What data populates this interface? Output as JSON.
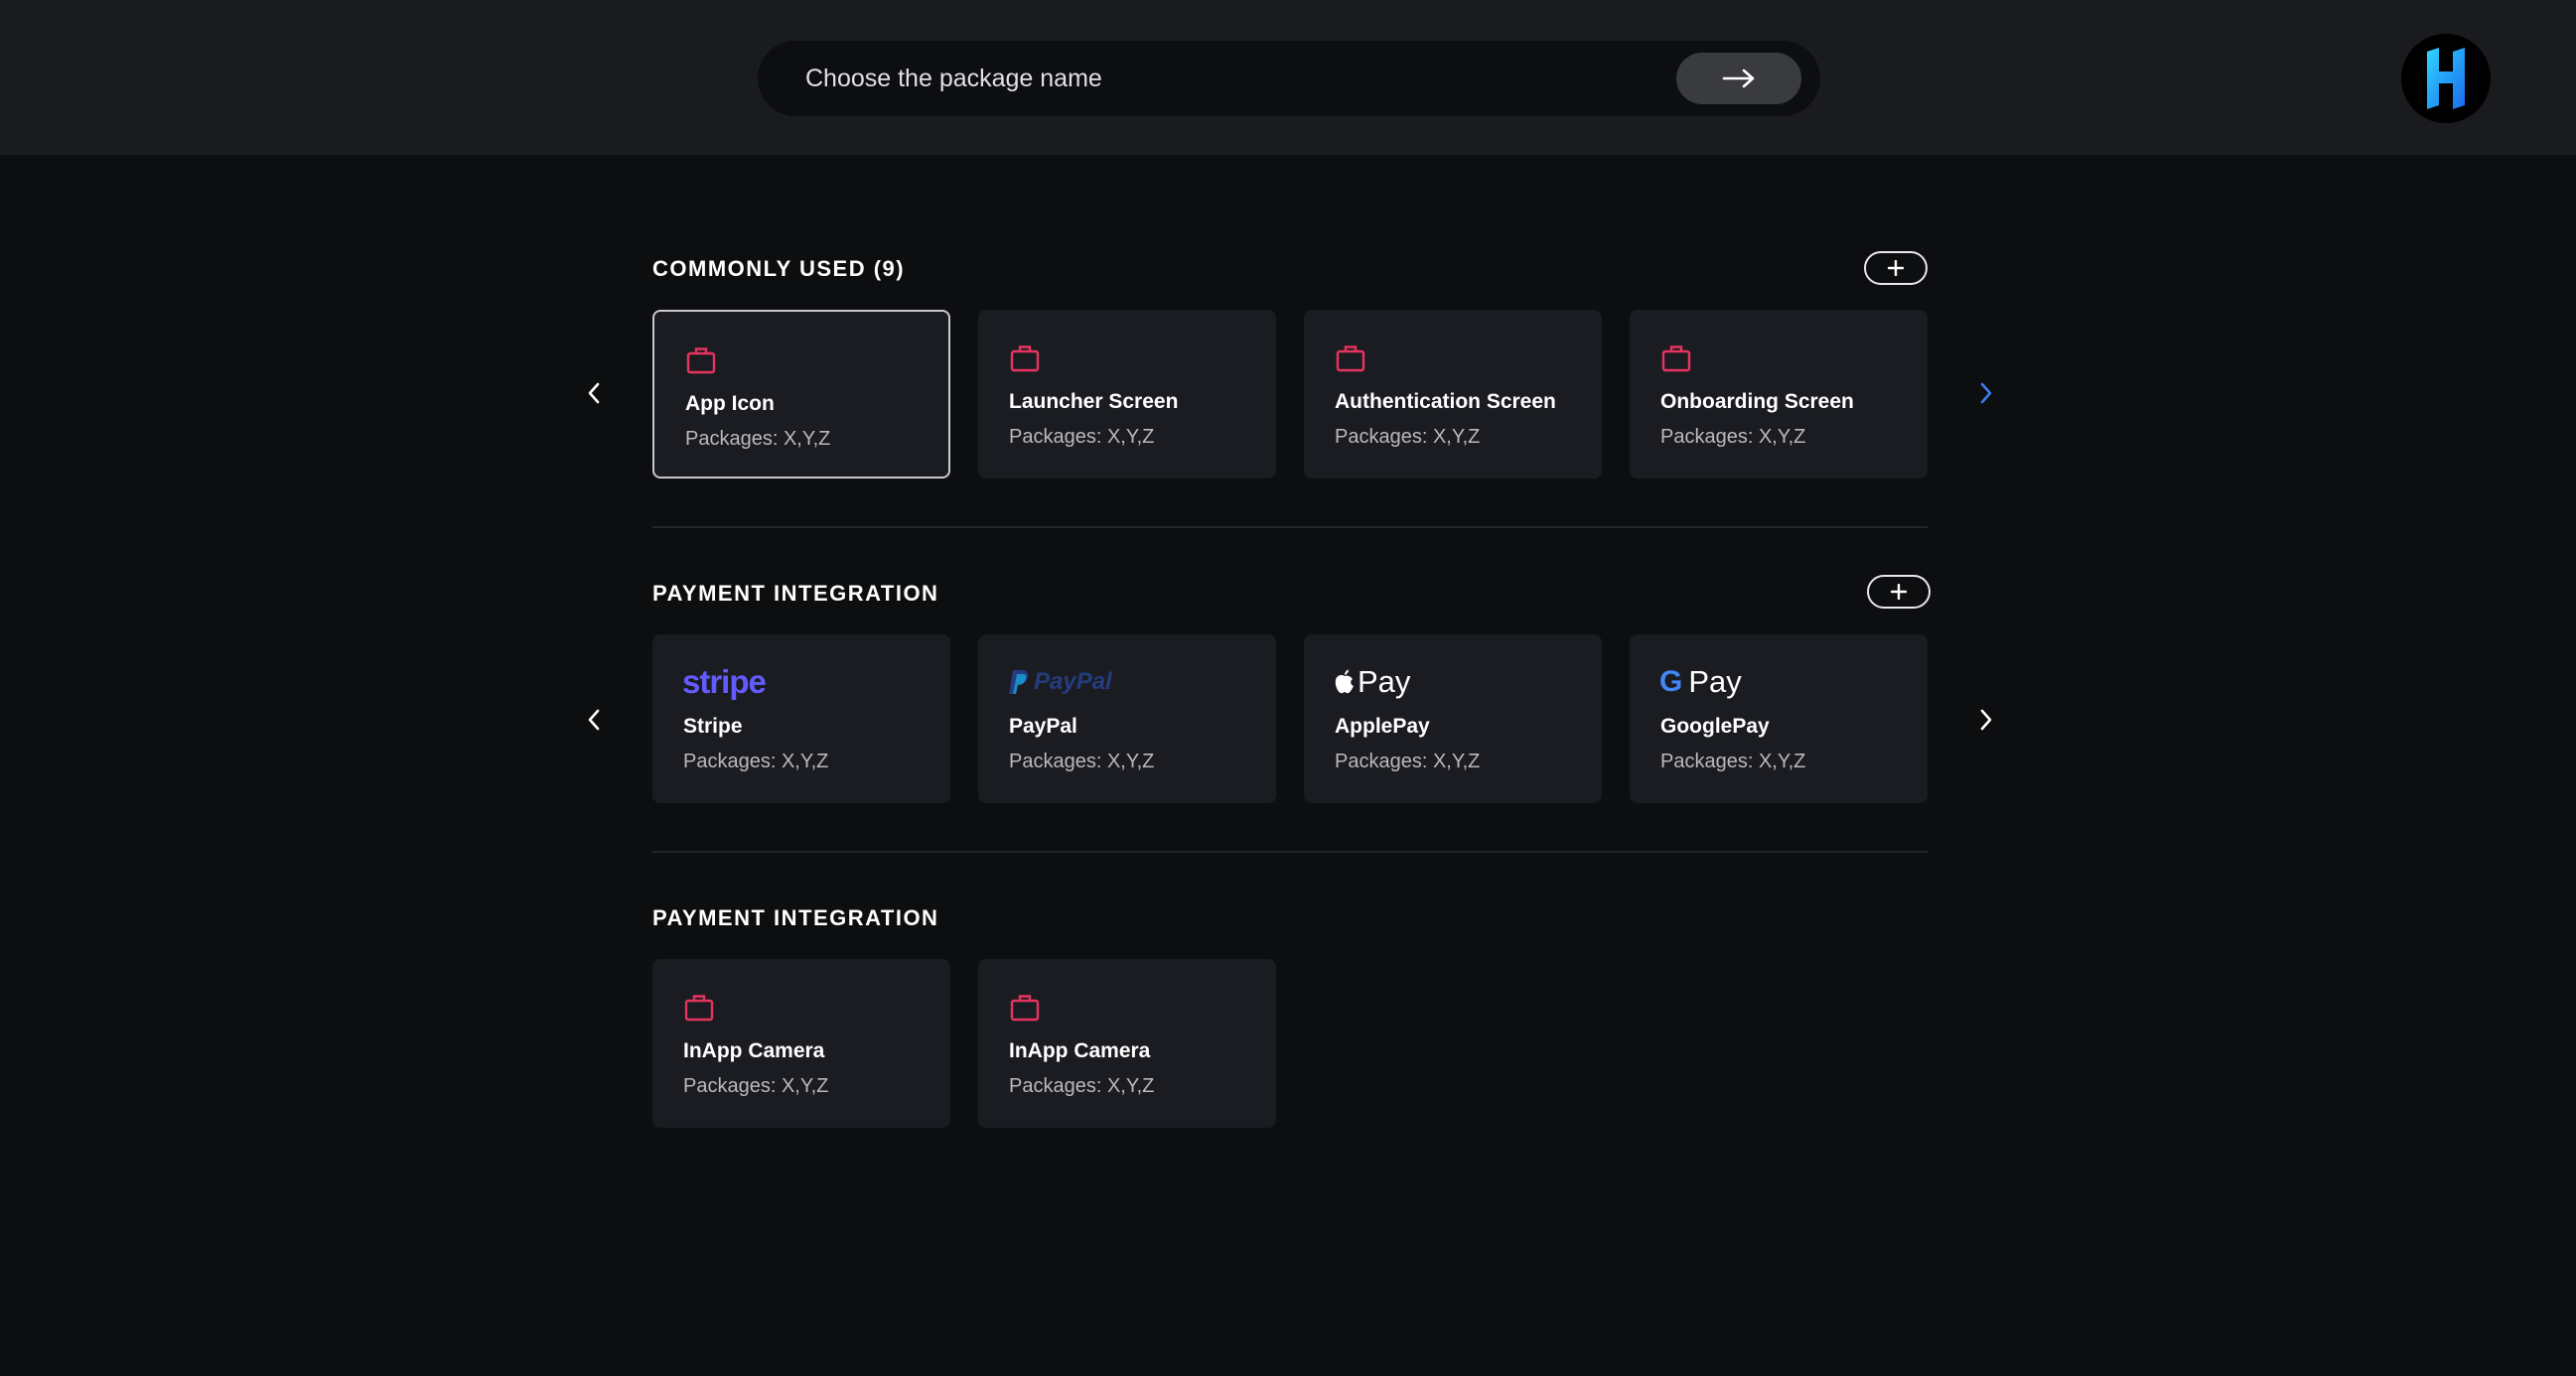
{
  "search": {
    "placeholder": "Choose the package name"
  },
  "logo": {
    "letter": "H",
    "icon": "h-logo-icon"
  },
  "sections": [
    {
      "title": "COMMONLY USED (9)",
      "cards": [
        {
          "title": "App Icon",
          "sub": "Packages: X,Y,Z",
          "icon": "briefcase-icon",
          "selected": true
        },
        {
          "title": "Launcher Screen",
          "sub": "Packages: X,Y,Z",
          "icon": "briefcase-icon"
        },
        {
          "title": "Authentication Screen",
          "sub": "Packages: X,Y,Z",
          "icon": "briefcase-icon"
        },
        {
          "title": "Onboarding Screen",
          "sub": "Packages: X,Y,Z",
          "icon": "briefcase-icon"
        }
      ]
    },
    {
      "title": "PAYMENT INTEGRATION",
      "cards": [
        {
          "title": "Stripe",
          "sub": "Packages: X,Y,Z",
          "icon": "stripe-logo",
          "brand": "stripe"
        },
        {
          "title": "PayPal",
          "sub": "Packages: X,Y,Z",
          "icon": "paypal-logo",
          "brand": "PayPal"
        },
        {
          "title": "ApplePay",
          "sub": "Packages: X,Y,Z",
          "icon": "apple-pay-logo",
          "brand": "Pay"
        },
        {
          "title": "GooglePay",
          "sub": "Packages: X,Y,Z",
          "icon": "google-pay-logo",
          "brand_g": "G",
          "brand": "Pay"
        }
      ]
    },
    {
      "title": "PAYMENT INTEGRATION",
      "cards": [
        {
          "title": "InApp Camera",
          "sub": "Packages: X,Y,Z",
          "icon": "briefcase-icon"
        },
        {
          "title": "InApp Camera",
          "sub": "Packages: X,Y,Z",
          "icon": "briefcase-icon"
        }
      ]
    }
  ],
  "colors": {
    "background": "#0d0e10",
    "topbar": "#1a1b1f",
    "card": "#1b1c21",
    "accent_icon": "#e5345f",
    "next_arrow_active": "#3d7bf0",
    "stripe": "#635bff",
    "paypal_dark": "#253b80",
    "paypal_light": "#179bd7"
  }
}
